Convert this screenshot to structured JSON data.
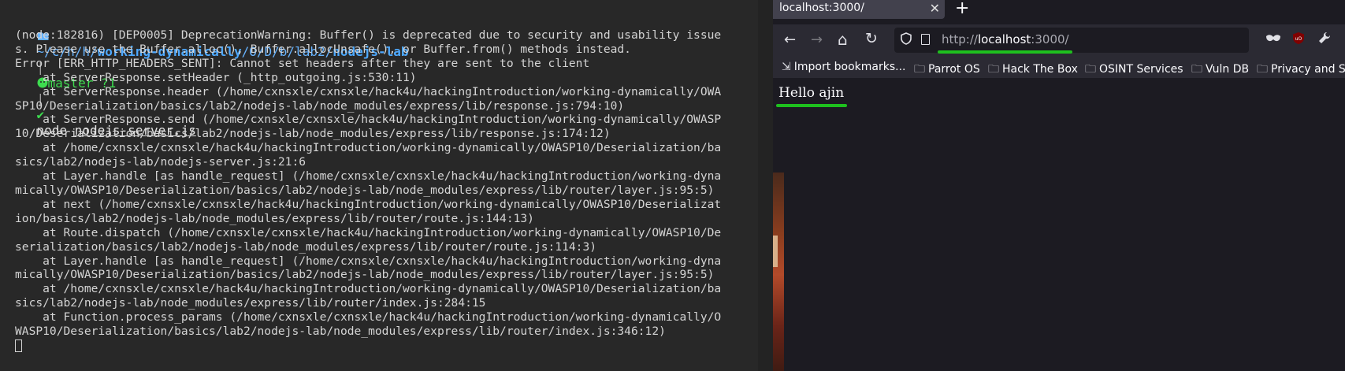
{
  "terminal": {
    "prompt": {
      "folder_icon": "folder-icon",
      "path_prefix": "~/c/h/h/",
      "path_dir1": "working-dynamically",
      "path_mid": "/O/D/b/",
      "path_lab2": "lab2",
      "path_slash": "/",
      "path_current": "nodejs-lab",
      "separator": "|",
      "git_icon": "github-icon",
      "git_branch": "master ?1",
      "separator2": "|",
      "status": "✔",
      "command": "node",
      "command_file": "nodejs-server.js"
    },
    "output_lines": [
      "(node:182816) [DEP0005] DeprecationWarning: Buffer() is deprecated due to security and usability issue",
      "s. Please use the Buffer.alloc(), Buffer.allocUnsafe(), or Buffer.from() methods instead.",
      "Error [ERR_HTTP_HEADERS_SENT]: Cannot set headers after they are sent to the client",
      "    at ServerResponse.setHeader (_http_outgoing.js:530:11)",
      "    at ServerResponse.header (/home/cxnsxle/cxnsxle/hack4u/hackingIntroduction/working-dynamically/OWA",
      "SP10/Deserialization/basics/lab2/nodejs-lab/node_modules/express/lib/response.js:794:10)",
      "    at ServerResponse.send (/home/cxnsxle/cxnsxle/hack4u/hackingIntroduction/working-dynamically/OWASP",
      "10/Deserialization/basics/lab2/nodejs-lab/node_modules/express/lib/response.js:174:12)",
      "    at /home/cxnsxle/cxnsxle/hack4u/hackingIntroduction/working-dynamically/OWASP10/Deserialization/ba",
      "sics/lab2/nodejs-lab/nodejs-server.js:21:6",
      "    at Layer.handle [as handle_request] (/home/cxnsxle/cxnsxle/hack4u/hackingIntroduction/working-dyna",
      "mically/OWASP10/Deserialization/basics/lab2/nodejs-lab/node_modules/express/lib/router/layer.js:95:5)",
      "    at next (/home/cxnsxle/cxnsxle/hack4u/hackingIntroduction/working-dynamically/OWASP10/Deserializat",
      "ion/basics/lab2/nodejs-lab/node_modules/express/lib/router/route.js:144:13)",
      "    at Route.dispatch (/home/cxnsxle/cxnsxle/hack4u/hackingIntroduction/working-dynamically/OWASP10/De",
      "serialization/basics/lab2/nodejs-lab/node_modules/express/lib/router/route.js:114:3)",
      "    at Layer.handle [as handle_request] (/home/cxnsxle/cxnsxle/hack4u/hackingIntroduction/working-dyna",
      "mically/OWASP10/Deserialization/basics/lab2/nodejs-lab/node_modules/express/lib/router/layer.js:95:5)",
      "    at /home/cxnsxle/cxnsxle/hack4u/hackingIntroduction/working-dynamically/OWASP10/Deserialization/ba",
      "sics/lab2/nodejs-lab/node_modules/express/lib/router/index.js:284:15",
      "    at Function.process_params (/home/cxnsxle/cxnsxle/hack4u/hackingIntroduction/working-dynamically/O",
      "WASP10/Deserialization/basics/lab2/nodejs-lab/node_modules/express/lib/router/index.js:346:12)"
    ]
  },
  "browser": {
    "tab": {
      "title": "localhost:3000/",
      "close_glyph": "✕"
    },
    "new_tab_glyph": "+",
    "nav": {
      "back_glyph": "←",
      "forward_glyph": "→",
      "home_glyph": "⌂",
      "reload_glyph": "↻"
    },
    "url": {
      "scheme": "http://",
      "host": "localhost",
      "rest": ":3000/"
    },
    "bookmarks": [
      {
        "label": "Import bookmarks...",
        "icon": "import-icon"
      },
      {
        "label": "Parrot OS",
        "icon": "folder-icon"
      },
      {
        "label": "Hack The Box",
        "icon": "folder-icon"
      },
      {
        "label": "OSINT Services",
        "icon": "folder-icon"
      },
      {
        "label": "Vuln DB",
        "icon": "folder-icon"
      },
      {
        "label": "Privacy and Se",
        "icon": "folder-icon"
      }
    ],
    "page": {
      "text": "Hello ajin"
    },
    "accent_color": "#1ec01e"
  }
}
